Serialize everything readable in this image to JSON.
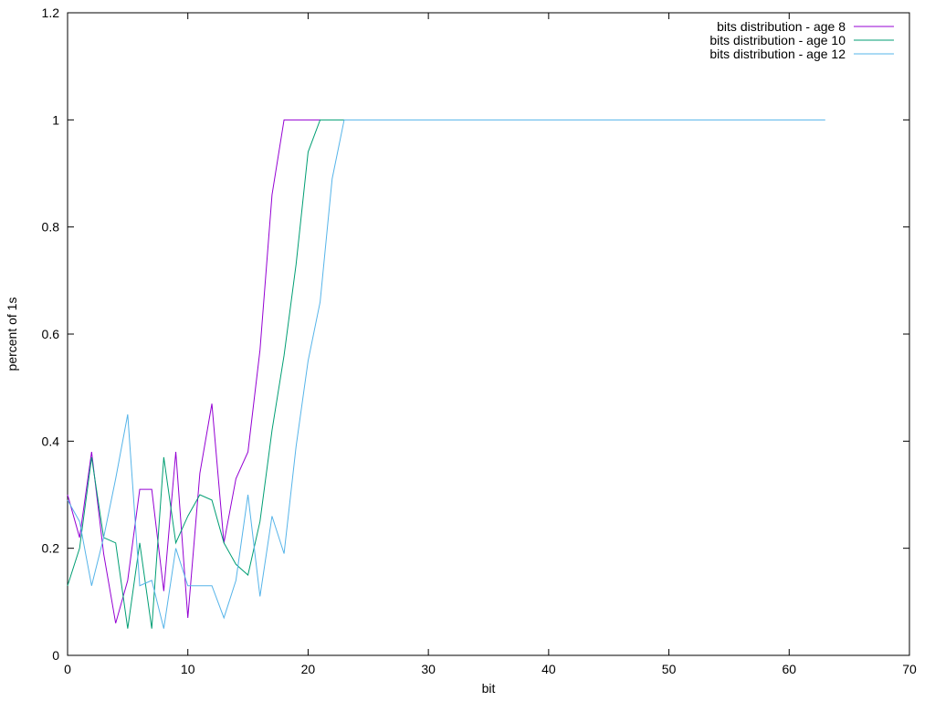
{
  "chart_data": {
    "type": "line",
    "title": "",
    "xlabel": "bit",
    "ylabel": "percent of 1s",
    "xlim": [
      0,
      70
    ],
    "ylim": [
      0,
      1.2
    ],
    "x_ticks": [
      "0",
      "10",
      "20",
      "30",
      "40",
      "50",
      "60",
      "70"
    ],
    "y_ticks": [
      "0",
      "0.2",
      "0.4",
      "0.6",
      "0.8",
      "1",
      "1.2"
    ],
    "grid": false,
    "legend_position": "top-right",
    "series": [
      {
        "name": "bits distribution - age 8",
        "color": "#9400d3",
        "x": [
          0,
          1,
          2,
          3,
          4,
          5,
          6,
          7,
          8,
          9,
          10,
          11,
          12,
          13,
          14,
          15,
          16,
          17,
          18,
          19,
          20,
          21
        ],
        "y": [
          0.3,
          0.22,
          0.38,
          0.19,
          0.06,
          0.14,
          0.31,
          0.31,
          0.12,
          0.38,
          0.07,
          0.34,
          0.47,
          0.21,
          0.33,
          0.38,
          0.57,
          0.86,
          1.0,
          1.0,
          1.0,
          1.0
        ]
      },
      {
        "name": "bits distribution - age 10",
        "color": "#009e73",
        "x": [
          0,
          1,
          2,
          3,
          4,
          5,
          6,
          7,
          8,
          9,
          10,
          11,
          12,
          13,
          14,
          15,
          16,
          17,
          18,
          19,
          20,
          21,
          22,
          23
        ],
        "y": [
          0.13,
          0.2,
          0.37,
          0.22,
          0.21,
          0.05,
          0.21,
          0.05,
          0.37,
          0.21,
          0.26,
          0.3,
          0.29,
          0.21,
          0.17,
          0.15,
          0.25,
          0.42,
          0.56,
          0.73,
          0.94,
          1.0,
          1.0,
          1.0
        ]
      },
      {
        "name": "bits distribution - age 12",
        "color": "#56b4e9",
        "x": [
          0,
          1,
          2,
          3,
          4,
          5,
          6,
          7,
          8,
          9,
          10,
          11,
          12,
          13,
          14,
          15,
          16,
          17,
          18,
          19,
          20,
          21,
          22,
          23,
          63
        ],
        "y": [
          0.29,
          0.25,
          0.13,
          0.22,
          0.33,
          0.45,
          0.13,
          0.14,
          0.05,
          0.2,
          0.13,
          0.13,
          0.13,
          0.07,
          0.14,
          0.3,
          0.11,
          0.26,
          0.19,
          0.39,
          0.55,
          0.66,
          0.89,
          1.0,
          1.0
        ]
      }
    ]
  }
}
